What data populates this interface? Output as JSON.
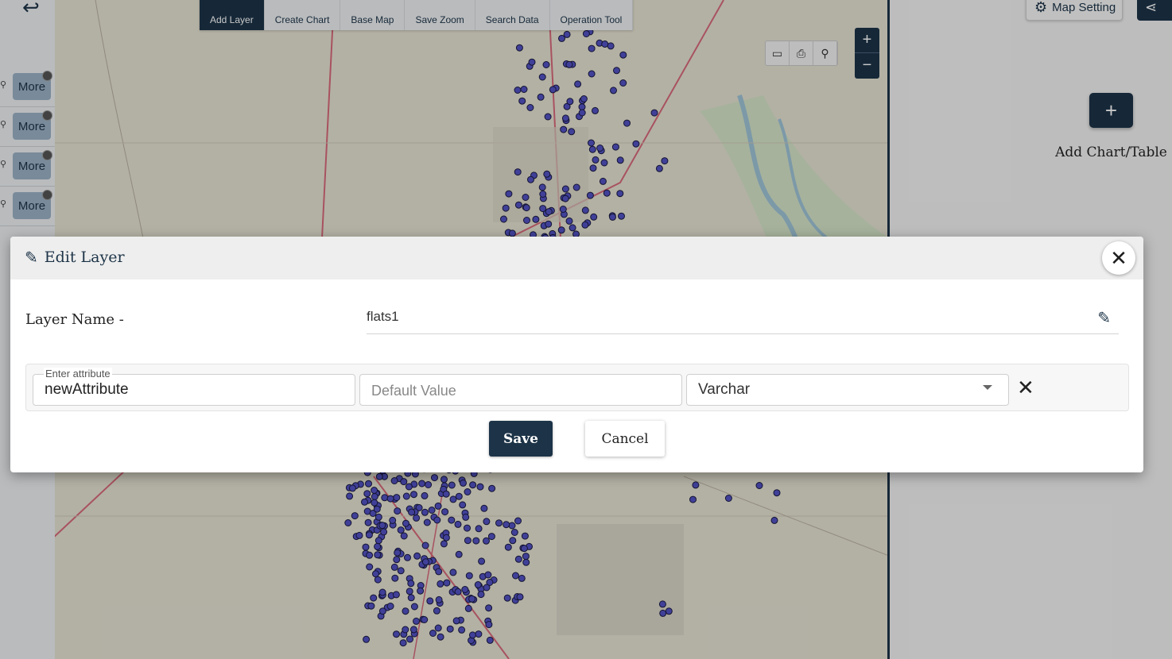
{
  "toolbar": {
    "items": [
      {
        "label": "Add Layer",
        "active": true
      },
      {
        "label": "Create Chart"
      },
      {
        "label": "Base Map"
      },
      {
        "label": "Save Zoom"
      },
      {
        "label": "Search Data"
      },
      {
        "label": "Operation Tool"
      }
    ]
  },
  "layer_list": {
    "more_label": "More"
  },
  "map": {
    "zoom_in": "+",
    "zoom_out": "−",
    "tools": [
      "ruler-icon",
      "print-icon",
      "search-icon"
    ]
  },
  "right_panel": {
    "map_setting_label": "Map Setting",
    "add_chart_label": "Add Chart/Table"
  },
  "modal": {
    "title": "Edit Layer",
    "layer_name_label": "Layer Name -",
    "layer_name_value": "flats1",
    "attribute": {
      "name_label": "Enter attribute",
      "name_value": "newAttribute",
      "default_placeholder": "Default Value",
      "type_value": "Varchar"
    },
    "save_label": "Save",
    "cancel_label": "Cancel"
  },
  "colors": {
    "primary": "#1d3448",
    "point": "#5353c4"
  }
}
